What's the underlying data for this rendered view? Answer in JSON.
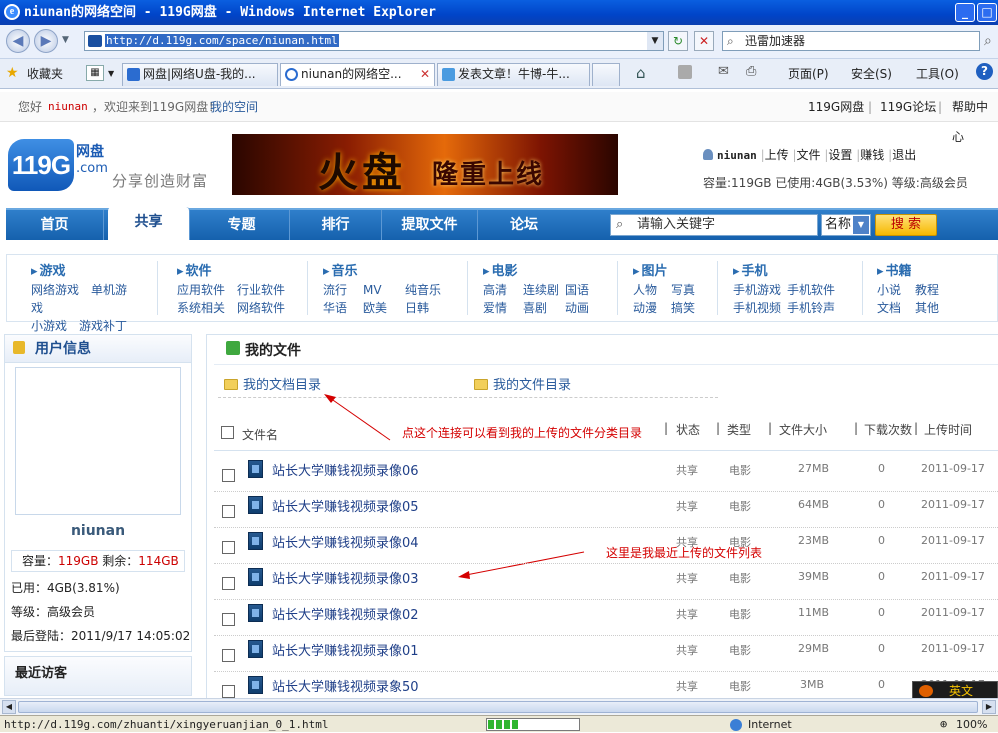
{
  "window": {
    "title": "niunan的网络空间 - 119G网盘 - Windows Internet Explorer"
  },
  "browser": {
    "url": "http://d.119g.com/space/niunan.html",
    "search_text": "迅雷加速器",
    "favorites_label": "收藏夹",
    "tabs": [
      {
        "label": "网盘|网络U盘-我的..."
      },
      {
        "label": "niunan的网络空..."
      },
      {
        "label": "发表文章！牛博-牛..."
      }
    ],
    "commands": {
      "page": "页面(P)",
      "safety": "安全(S)",
      "tools": "工具(O)"
    }
  },
  "topbar": {
    "hello": "您好",
    "user": "niunan",
    "welcome": "，欢迎来到119G网盘！",
    "my_space": "我的空间",
    "links": [
      "119G网盘",
      "119G论坛",
      "帮助中心"
    ]
  },
  "logo": {
    "brand": "119G",
    "cn": "网盘",
    "domain": ".com",
    "slogan": "分享创造财富"
  },
  "banner": {
    "text1": "火盘",
    "text2": "隆重上线"
  },
  "userbar": {
    "name": "niunan",
    "links": [
      "上传",
      "文件",
      "设置",
      "赚钱",
      "退出"
    ],
    "quota": "容量:119GB 已使用:4GB(3.53%) 等级:高级会员"
  },
  "nav": {
    "items": [
      "首页",
      "共享",
      "专题",
      "排行",
      "提取文件",
      "论坛"
    ],
    "search_placeholder": "请输入关键字",
    "search_type": "名称",
    "search_button": "搜 索"
  },
  "categories": [
    {
      "title": "游戏",
      "links": [
        "网络游戏",
        "单机游戏",
        "小游戏",
        "游戏补丁"
      ]
    },
    {
      "title": "软件",
      "links": [
        "应用软件",
        "行业软件",
        "系统相关",
        "网络软件"
      ]
    },
    {
      "title": "音乐",
      "links": [
        "流行",
        "MV",
        "纯音乐",
        "华语",
        "欧美",
        "日韩"
      ]
    },
    {
      "title": "电影",
      "links": [
        "高清",
        "连续剧",
        "国语",
        "爱情",
        "喜剧",
        "动画"
      ]
    },
    {
      "title": "图片",
      "links": [
        "人物",
        "写真",
        "动漫",
        "搞笑"
      ]
    },
    {
      "title": "手机",
      "links": [
        "手机游戏",
        "手机软件",
        "手机视频",
        "手机铃声"
      ]
    },
    {
      "title": "书籍",
      "links": [
        "小说",
        "教程",
        "文档",
        "其他"
      ]
    }
  ],
  "user_info": {
    "title": "用户信息",
    "name": "niunan",
    "capacity_label": "容量：",
    "capacity": "119GB",
    "remain_label": "剩余：",
    "remain": "114GB",
    "used": "已用：4GB(3.81%)",
    "level": "等级：高级会员",
    "last_login": "最后登陆：2011/9/17 14:05:02",
    "visitors_title": "最近访客"
  },
  "files": {
    "title": "我的文件",
    "doc_dir": "我的文档目录",
    "file_dir": "我的文件目录",
    "annotation1": "点这个连接可以看到我的上传的文件分类目录",
    "annotation2": "这里是我最近上传的文件列表",
    "columns": [
      "文件名",
      "状态",
      "类型",
      "文件大小",
      "下载次数",
      "上传时间"
    ],
    "rows": [
      {
        "name": "站长大学赚钱视频录像06",
        "status": "共享",
        "type": "电影",
        "size": "27MB",
        "downloads": "0",
        "date": "2011-09-17"
      },
      {
        "name": "站长大学赚钱视频录像05",
        "status": "共享",
        "type": "电影",
        "size": "64MB",
        "downloads": "0",
        "date": "2011-09-17"
      },
      {
        "name": "站长大学赚钱视频录像04",
        "status": "共享",
        "type": "电影",
        "size": "23MB",
        "downloads": "0",
        "date": "2011-09-17"
      },
      {
        "name": "站长大学赚钱视频录像03",
        "status": "共享",
        "type": "电影",
        "size": "39MB",
        "downloads": "0",
        "date": "2011-09-17"
      },
      {
        "name": "站长大学赚钱视频录像02",
        "status": "共享",
        "type": "电影",
        "size": "11MB",
        "downloads": "0",
        "date": "2011-09-17"
      },
      {
        "name": "站长大学赚钱视频录像01",
        "status": "共享",
        "type": "电影",
        "size": "29MB",
        "downloads": "0",
        "date": "2011-09-17"
      },
      {
        "name": "站长大学赚钱视频录象50",
        "status": "共享",
        "type": "电影",
        "size": "3MB",
        "downloads": "0",
        "date": "2011-09-17"
      }
    ]
  },
  "ime": {
    "label": "英文"
  },
  "statusbar": {
    "url": "http://d.119g.com/zhuanti/xingyeruanjian_0_1.html",
    "zone": "Internet",
    "zoom": "100%"
  }
}
